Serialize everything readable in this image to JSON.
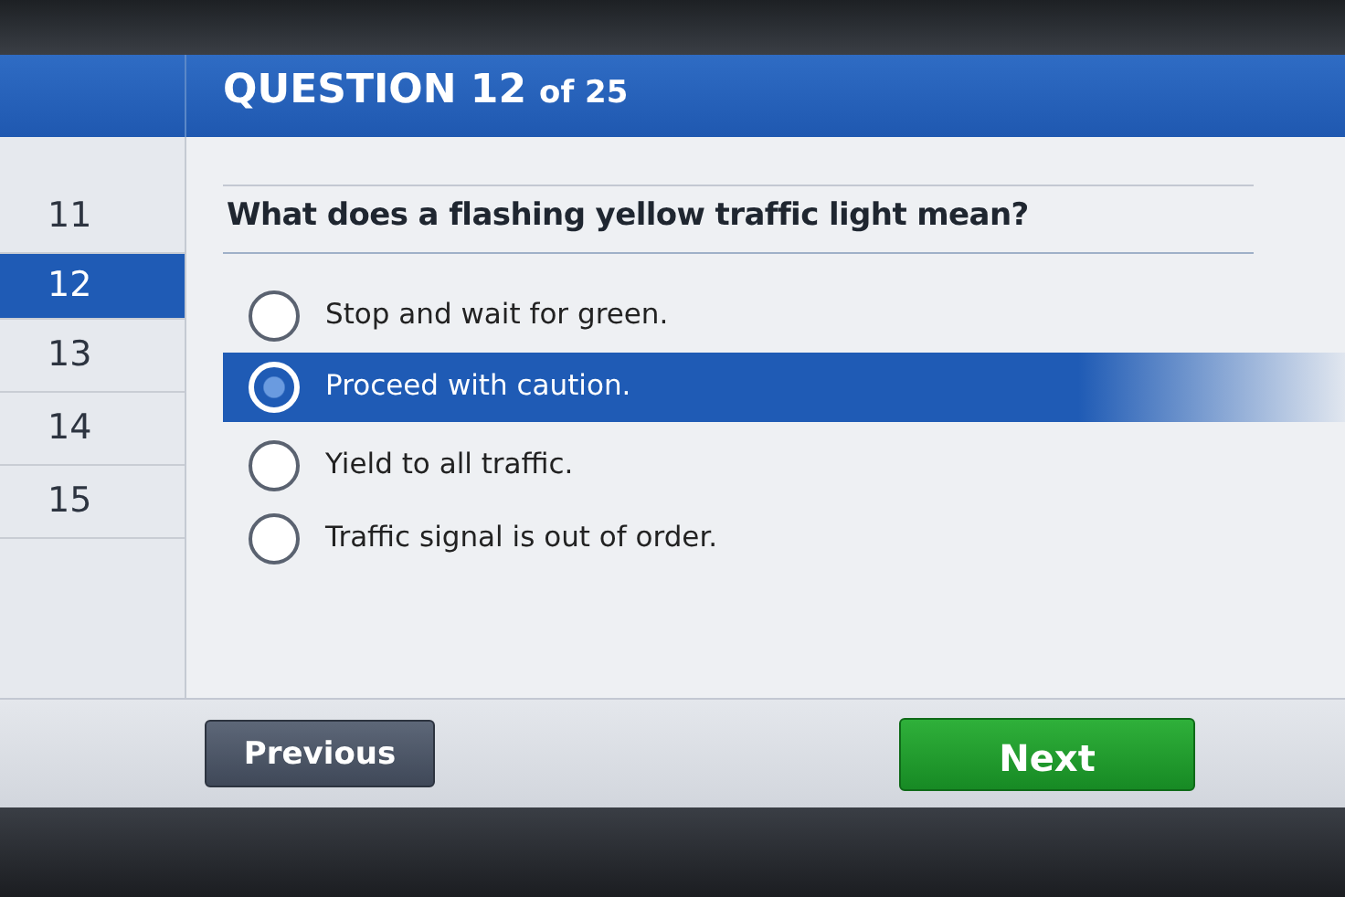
{
  "header": {
    "title": "QUESTION 12",
    "counter": "of 25"
  },
  "sidebar": {
    "items": [
      {
        "label": "11",
        "selected": false
      },
      {
        "label": "12",
        "selected": true
      },
      {
        "label": "13",
        "selected": false
      },
      {
        "label": "14",
        "selected": false
      },
      {
        "label": "15",
        "selected": false
      }
    ]
  },
  "question": "What does a flashing yellow traffic light mean?",
  "options": [
    {
      "label": "Stop and wait for green.",
      "selected": false
    },
    {
      "label": "Proceed with caution.",
      "selected": true
    },
    {
      "label": "Yield to all traffic.",
      "selected": false
    },
    {
      "label": "Traffic signal is out of order.",
      "selected": false
    }
  ],
  "buttons": [
    {
      "label": "Previous",
      "kind": "secondary"
    },
    {
      "label": "Next",
      "kind": "primary"
    }
  ]
}
